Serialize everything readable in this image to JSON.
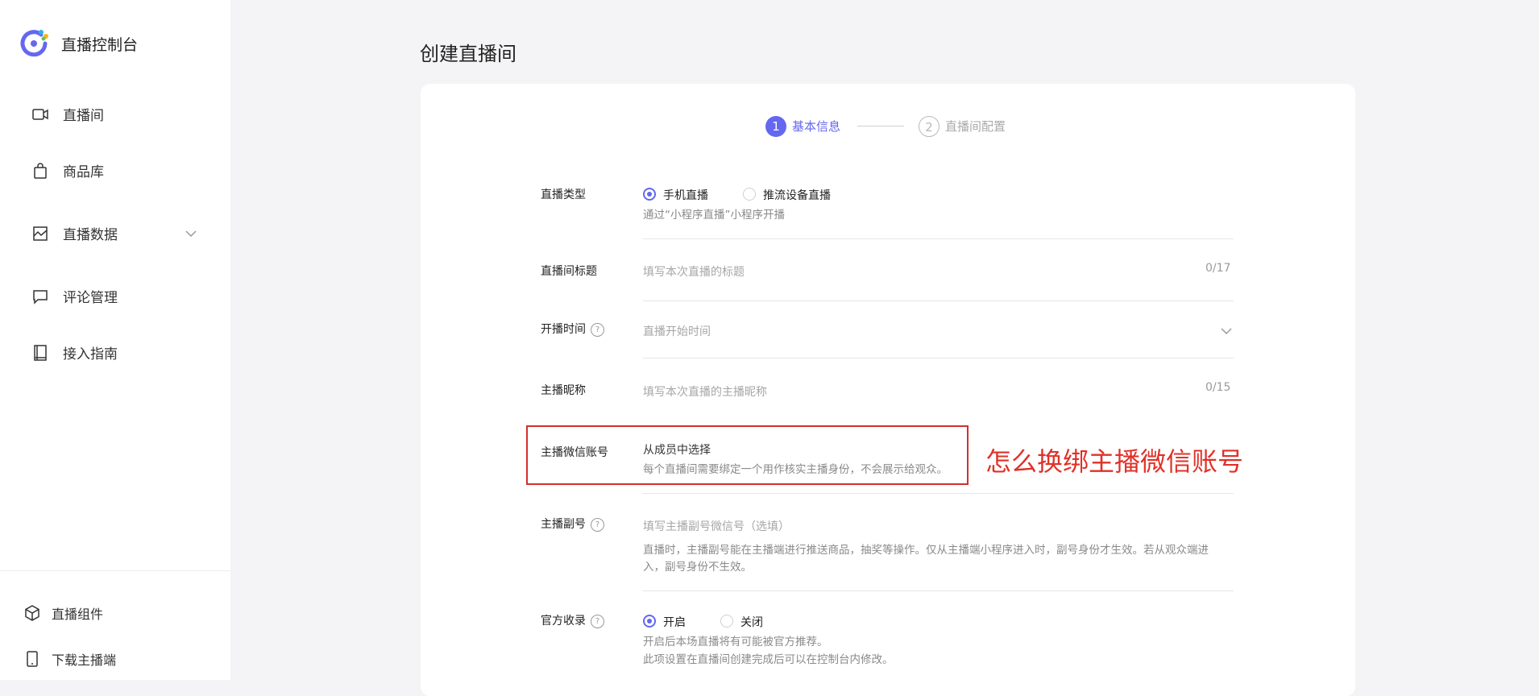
{
  "app": {
    "title": "直播控制台"
  },
  "sidebar": {
    "items": [
      {
        "label": "直播间",
        "icon": "video-camera-icon"
      },
      {
        "label": "商品库",
        "icon": "shopping-bag-icon"
      },
      {
        "label": "直播数据",
        "icon": "chart-icon"
      },
      {
        "label": "评论管理",
        "icon": "comment-icon"
      },
      {
        "label": "接入指南",
        "icon": "book-icon"
      }
    ],
    "bottom": [
      {
        "label": "直播组件",
        "icon": "cube-icon"
      },
      {
        "label": "下载主播端",
        "icon": "phone-icon"
      }
    ]
  },
  "page": {
    "title": "创建直播间"
  },
  "steps": [
    {
      "num": "1",
      "label": "基本信息",
      "active": true
    },
    {
      "num": "2",
      "label": "直播间配置",
      "active": false
    }
  ],
  "form": {
    "type": {
      "label": "直播类型",
      "options": [
        "手机直播",
        "推流设备直播"
      ],
      "hint": "通过“小程序直播”小程序开播"
    },
    "title": {
      "label": "直播间标题",
      "placeholder": "填写本次直播的标题",
      "counter": "0/17"
    },
    "time": {
      "label": "开播时间",
      "placeholder": "直播开始时间"
    },
    "nickname": {
      "label": "主播昵称",
      "placeholder": "填写本次直播的主播昵称",
      "counter": "0/15"
    },
    "wechat": {
      "label": "主播微信账号",
      "link": "从成员中选择",
      "hint": "每个直播间需要绑定一个用作核实主播身份，不会展示给观众。"
    },
    "sub": {
      "label": "主播副号",
      "placeholder": "填写主播副号微信号（选填）",
      "hint1": "直播时，主播副号能在主播端进行推送商品，抽奖等操作。仅从主播端小程序进入时，副号身份才生效。若从观众端进",
      "hint2": "入，副号身份不生效。"
    },
    "official": {
      "label": "官方收录",
      "options": [
        "开启",
        "关闭"
      ],
      "hint1": "开启后本场直播将有可能被官方推荐。",
      "hint2": "此项设置在直播间创建完成后可以在控制台内修改。"
    }
  },
  "annotation": "怎么换绑主播微信账号",
  "colors": {
    "accent": "#6467f0",
    "annotation_red": "#e03128"
  }
}
